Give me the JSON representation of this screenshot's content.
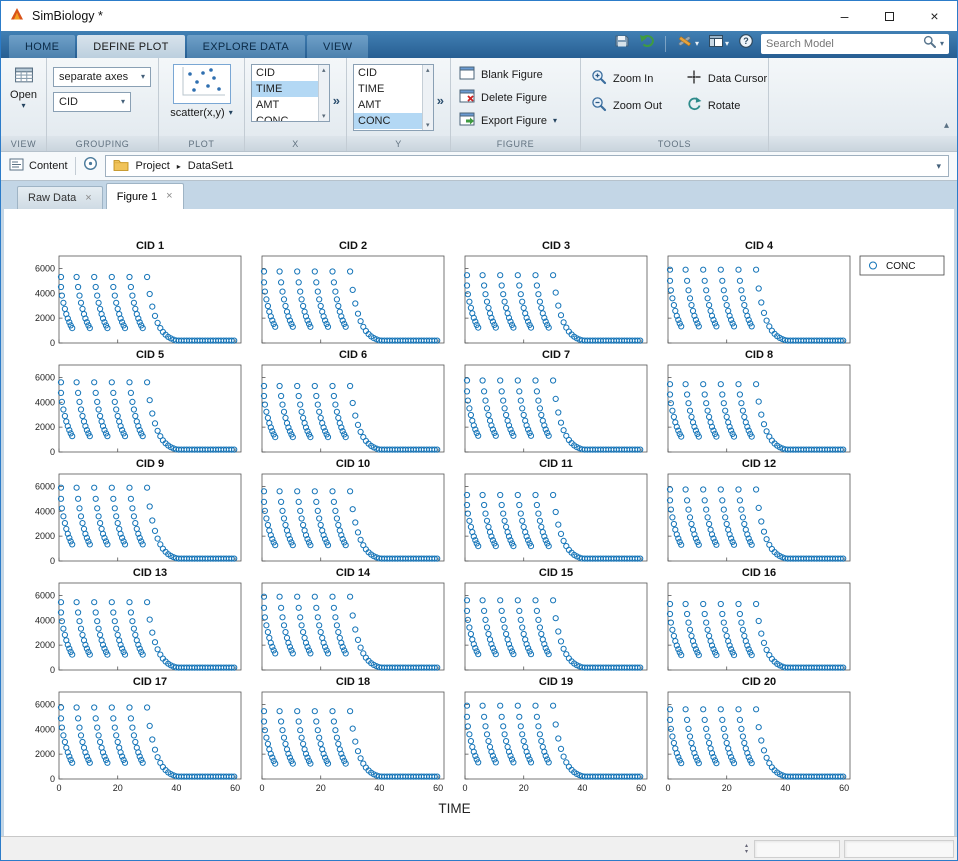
{
  "window": {
    "title": "SimBiology *"
  },
  "icons": {
    "caret_down": "▾",
    "chevrons_right": "»",
    "close_tab": "×",
    "close_window": "×",
    "minimize": "–",
    "breadcrumb_arrow": "▸",
    "scroll_up": "▴",
    "scroll_down": "▾",
    "collapse_ribbon": "▴"
  },
  "ribbon": {
    "tabs": [
      {
        "label": "HOME"
      },
      {
        "label": "DEFINE PLOT"
      },
      {
        "label": "EXPLORE DATA"
      },
      {
        "label": "VIEW"
      }
    ],
    "active_tab": "DEFINE PLOT",
    "search_placeholder": "Search Model",
    "sections": {
      "view": {
        "label": "VIEW",
        "open": "Open"
      },
      "grouping": {
        "label": "GROUPING",
        "axes_mode": "separate axes",
        "group_by": "CID"
      },
      "plot": {
        "label": "PLOT",
        "selected_plot": "scatter(x,y)"
      },
      "x": {
        "label": "X",
        "items": [
          "CID",
          "TIME",
          "AMT",
          "CONC"
        ],
        "selected": "TIME"
      },
      "y": {
        "label": "Y",
        "items": [
          "CID",
          "TIME",
          "AMT",
          "CONC"
        ],
        "selected": "CONC"
      },
      "figure": {
        "label": "FIGURE",
        "blank": "Blank Figure",
        "delete": "Delete Figure",
        "export": "Export Figure"
      },
      "tools": {
        "label": "TOOLS",
        "zoom_in": "Zoom In",
        "zoom_out": "Zoom Out",
        "data_cursor": "Data Cursor",
        "rotate": "Rotate"
      }
    }
  },
  "pathbar": {
    "content": "Content",
    "crumbs": [
      "Project",
      "DataSet1"
    ]
  },
  "doc_tabs": [
    {
      "label": "Raw Data"
    },
    {
      "label": "Figure 1"
    }
  ],
  "active_doc_tab": "Figure 1",
  "chart_data": {
    "type": "scatter",
    "subplots": [
      "CID 1",
      "CID 2",
      "CID 3",
      "CID 4",
      "CID 5",
      "CID 6",
      "CID 7",
      "CID 8",
      "CID 9",
      "CID 10",
      "CID 11",
      "CID 12",
      "CID 13",
      "CID 14",
      "CID 15",
      "CID 16",
      "CID 17",
      "CID 18",
      "CID 19",
      "CID 20"
    ],
    "xlabel": "TIME",
    "legend": [
      "CONC"
    ],
    "xticks": [
      0,
      20,
      40,
      60
    ],
    "yticks": [
      0,
      2000,
      4000,
      6000
    ],
    "xlim": [
      0,
      62
    ],
    "ylim": [
      0,
      7000
    ],
    "marker": "circle",
    "marker_color": "#1474b8",
    "dose_times": [
      0,
      6,
      12,
      18,
      24,
      30
    ],
    "peak_value": 5900,
    "decay_rate": 0.33
  }
}
